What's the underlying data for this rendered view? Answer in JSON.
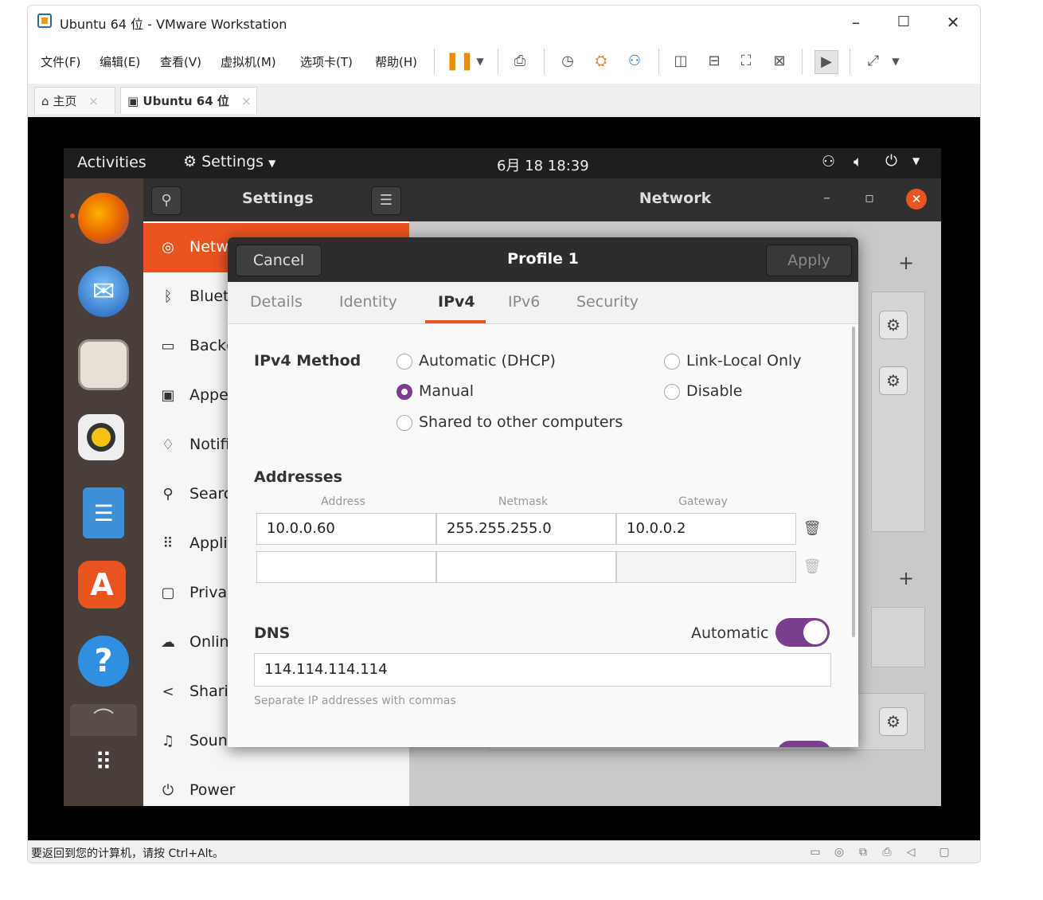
{
  "vmware": {
    "title": "Ubuntu 64 位 - VMware Workstation",
    "window_controls": {
      "minimize": "–",
      "maximize": "☐",
      "close": "✕"
    },
    "menu": [
      "文件(F)",
      "编辑(E)",
      "查看(V)",
      "虚拟机(M)",
      "选项卡(T)",
      "帮助(H)"
    ],
    "tabs": [
      {
        "label": "主页",
        "close": "×"
      },
      {
        "label": "Ubuntu 64 位",
        "close": "×"
      }
    ],
    "status_message": "要返回到您的计算机，请按 Ctrl+Alt。"
  },
  "ubuntu": {
    "topbar": {
      "activities": "Activities",
      "app_menu": "Settings",
      "clock": "6月 18  18:39"
    },
    "settings_header": {
      "title": "Settings"
    },
    "network_header": {
      "title": "Network",
      "minimize": "–",
      "restore": "▫"
    },
    "sidebar_items": [
      {
        "label": "Network",
        "icon": "network-icon",
        "glyph": "◎"
      },
      {
        "label": "Bluetooth",
        "icon": "bluetooth-icon",
        "glyph": "ᛒ"
      },
      {
        "label": "Background",
        "icon": "background-icon",
        "glyph": "▭"
      },
      {
        "label": "Appearance",
        "icon": "appearance-icon",
        "glyph": "▣"
      },
      {
        "label": "Notifications",
        "icon": "bell-icon",
        "glyph": "♢"
      },
      {
        "label": "Search",
        "icon": "search-icon",
        "glyph": "⚲"
      },
      {
        "label": "Applications",
        "icon": "apps-icon",
        "glyph": "⠿"
      },
      {
        "label": "Privacy",
        "icon": "lock-icon",
        "glyph": "▢"
      },
      {
        "label": "Online Accounts",
        "icon": "cloud-icon",
        "glyph": "☁"
      },
      {
        "label": "Sharing",
        "icon": "share-icon",
        "glyph": "<"
      },
      {
        "label": "Sound",
        "icon": "music-icon",
        "glyph": "♫"
      },
      {
        "label": "Power",
        "icon": "power-icon",
        "glyph": "⏻"
      }
    ],
    "content_plus": "+"
  },
  "dialog": {
    "cancel": "Cancel",
    "title": "Profile 1",
    "apply": "Apply",
    "tabs": [
      "Details",
      "Identity",
      "IPv4",
      "IPv6",
      "Security"
    ],
    "active_tab": "IPv4",
    "ipv4_method_label": "IPv4 Method",
    "methods": [
      {
        "label": "Automatic (DHCP)",
        "selected": false
      },
      {
        "label": "Manual",
        "selected": true
      },
      {
        "label": "Shared to other computers",
        "selected": false
      },
      {
        "label": "Link-Local Only",
        "selected": false
      },
      {
        "label": "Disable",
        "selected": false
      }
    ],
    "addresses_label": "Addresses",
    "columns": [
      "Address",
      "Netmask",
      "Gateway"
    ],
    "rows": [
      {
        "address": "10.0.0.60",
        "netmask": "255.255.255.0",
        "gateway": "10.0.0.2"
      },
      {
        "address": "",
        "netmask": "",
        "gateway": ""
      }
    ],
    "dns_label": "DNS",
    "dns_automatic_label": "Automatic",
    "dns_automatic_on": true,
    "dns_value": "114.114.114.114",
    "dns_hint": "Separate IP addresses with commas"
  },
  "colors": {
    "ubuntu_orange": "#e95420",
    "toggle_purple": "#7a3e8c",
    "header_dark": "#2d2d2d"
  }
}
